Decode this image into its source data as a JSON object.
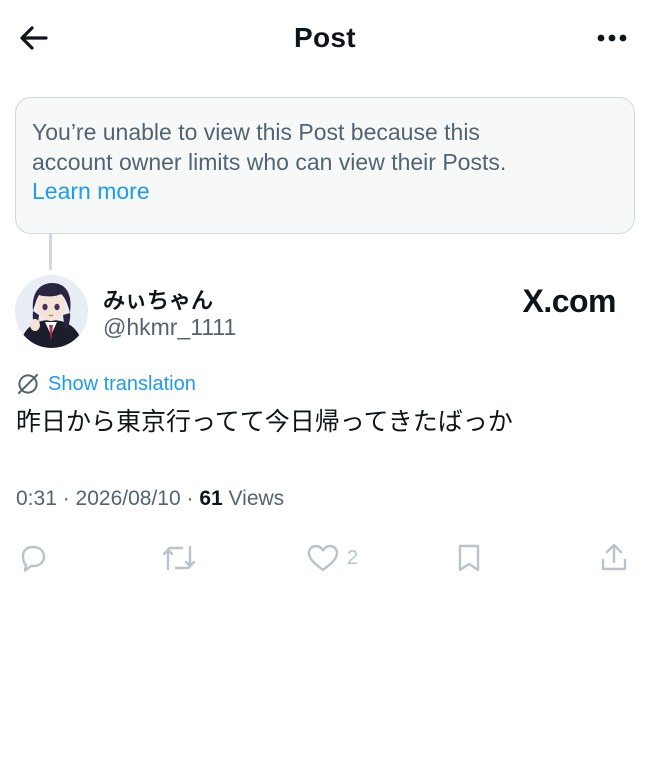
{
  "header": {
    "title": "Post",
    "back_icon": "arrow-left-icon",
    "more_icon": "more-horizontal-icon"
  },
  "notice": {
    "line1": "You’re unable to view this Post because this",
    "line2": "account owner limits who can view their Posts.",
    "link": "Learn more"
  },
  "author": {
    "display_name": "みぃちゃん",
    "username": "@hkmr_1111"
  },
  "watermark": "X.com",
  "translation": {
    "label": "Show translation",
    "icon": "translate-globe-icon"
  },
  "post": {
    "text": "昨日から東京行ってて今日帰ってきたばっか",
    "time": "0:31",
    "date": "2026/08/10",
    "views_count": "61",
    "views_label": "Views"
  },
  "actions": {
    "like_count": "2"
  },
  "colors": {
    "accent": "#1d9bf0",
    "text": "#0f1419",
    "muted": "#536471",
    "border": "#cfd9de",
    "action_muted": "#b8c3cb"
  }
}
